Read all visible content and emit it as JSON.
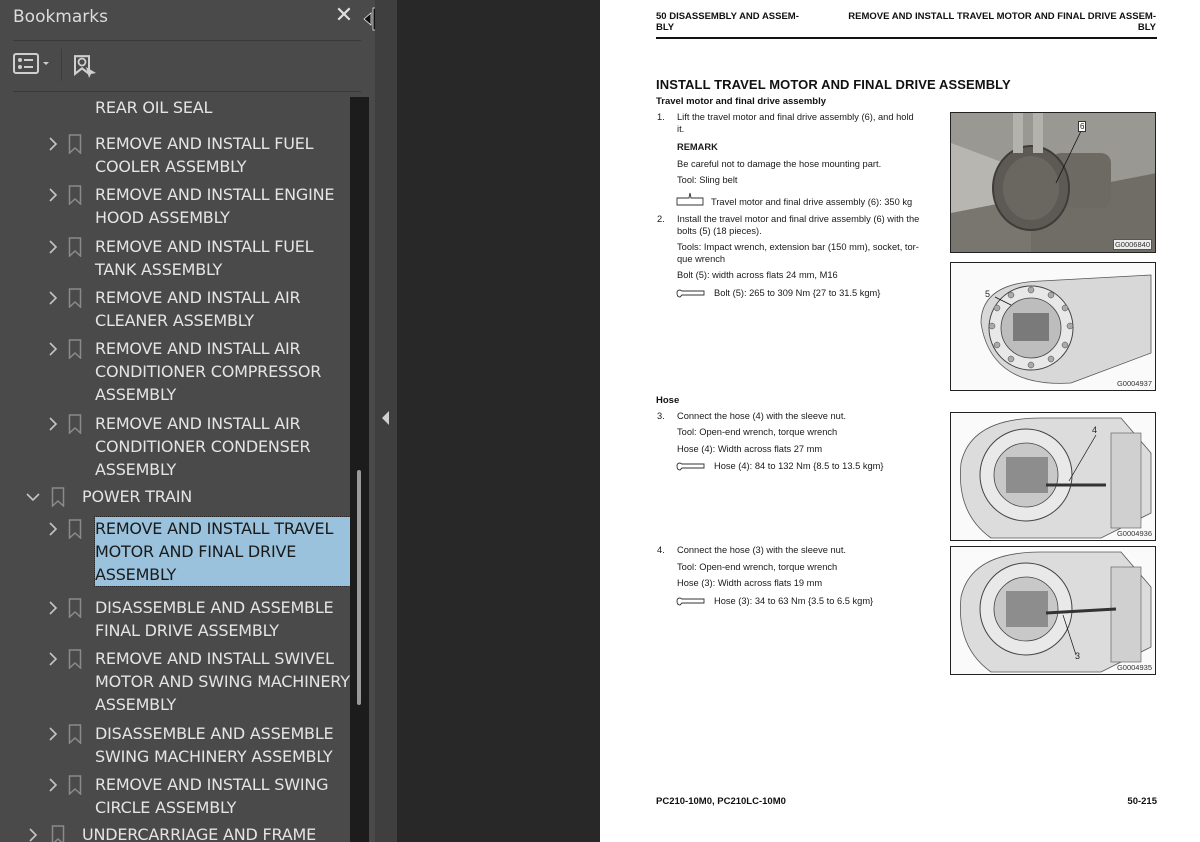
{
  "sidebar": {
    "title": "Bookmarks",
    "close_icon": "close-icon",
    "options_icon": "bookmark-options-icon",
    "find_icon": "find-current-bookmark-icon",
    "items": [
      {
        "level": 2,
        "label": "REAR OIL SEAL",
        "expanded": false,
        "partial": true
      },
      {
        "level": 2,
        "label": " REMOVE AND INSTALL FUEL\nCOOLER ASSEMBLY",
        "expanded": false
      },
      {
        "level": 2,
        "label": " REMOVE AND INSTALL ENGINE\nHOOD ASSEMBLY",
        "expanded": false
      },
      {
        "level": 2,
        "label": " REMOVE AND INSTALL FUEL\nTANK ASSEMBLY",
        "expanded": false
      },
      {
        "level": 2,
        "label": " REMOVE AND INSTALL AIR\nCLEANER ASSEMBLY",
        "expanded": false
      },
      {
        "level": 2,
        "label": " REMOVE AND INSTALL AIR\nCONDITIONER COMPRESSOR\nASSEMBLY",
        "expanded": false
      },
      {
        "level": 2,
        "label": " REMOVE AND INSTALL AIR\nCONDITIONER CONDENSER\nASSEMBLY",
        "expanded": false
      },
      {
        "level": 1,
        "label": "POWER TRAIN",
        "expanded": true
      },
      {
        "level": 2,
        "label": " REMOVE AND INSTALL TRAVEL\nMOTOR AND FINAL DRIVE\nASSEMBLY",
        "expanded": false,
        "selected": true
      },
      {
        "level": 2,
        "label": " DISASSEMBLE AND ASSEMBLE\nFINAL DRIVE ASSEMBLY",
        "expanded": false
      },
      {
        "level": 2,
        "label": " REMOVE AND INSTALL SWIVEL\nMOTOR AND SWING MACHINERY\nASSEMBLY",
        "expanded": false
      },
      {
        "level": 2,
        "label": " DISASSEMBLE AND ASSEMBLE\nSWING MACHINERY ASSEMBLY",
        "expanded": false
      },
      {
        "level": 2,
        "label": " REMOVE AND INSTALL SWING\nCIRCLE ASSEMBLY",
        "expanded": false
      },
      {
        "level": 1,
        "label": "UNDERCARRIAGE AND FRAME",
        "expanded": false
      }
    ]
  },
  "page": {
    "header_left": "50 DISASSEMBLY AND ASSEM-\nBLY",
    "header_right": "REMOVE AND INSTALL TRAVEL MOTOR AND FINAL DRIVE ASSEM-\nBLY",
    "title": "INSTALL TRAVEL MOTOR AND FINAL DRIVE ASSEMBLY",
    "section1_heading": "Travel motor and final drive assembly",
    "step1": {
      "number": "1.",
      "text": "Lift the travel motor and final drive assembly (6), and hold\nit.",
      "remark_label": "REMARK",
      "remark_text": "Be careful not to damage the hose mounting part.",
      "tool": "Tool: Sling belt",
      "weight": "Travel motor and final drive assembly (6): 350 kg"
    },
    "step2": {
      "number": "2.",
      "text": "Install the travel motor and final drive assembly (6) with the\nbolts (5) (18 pieces).",
      "tools": "Tools: Impact wrench, extension bar (150 mm), socket, tor-\nque wrench",
      "spec": "Bolt (5): width across flats 24 mm, M16",
      "torque": "Bolt (5): 265 to 309 Nm {27 to 31.5 kgm}"
    },
    "section2_heading": "Hose",
    "step3": {
      "number": "3.",
      "text": "Connect the hose (4) with the sleeve nut.",
      "tool": "Tool: Open-end wrench, torque wrench",
      "spec": "Hose (4): Width across flats 27 mm",
      "torque": "Hose (4): 84 to 132 Nm {8.5 to 13.5 kgm}"
    },
    "step4": {
      "number": "4.",
      "text": "Connect the hose (3) with the sleeve nut.",
      "tool": "Tool: Open-end wrench, torque wrench",
      "spec": "Hose (3): Width across flats 19 mm",
      "torque": "Hose (3): 34 to 63 Nm {3.5 to 6.5 kgm}"
    },
    "figures": [
      {
        "id": "G0006840",
        "callout": "6"
      },
      {
        "id": "G0004937",
        "callout": "5"
      },
      {
        "id": "G0004936",
        "callout": "4"
      },
      {
        "id": "G0004935",
        "callout": "3"
      }
    ],
    "footer_left": "PC210-10M0, PC210LC-10M0",
    "footer_right": "50-215"
  }
}
